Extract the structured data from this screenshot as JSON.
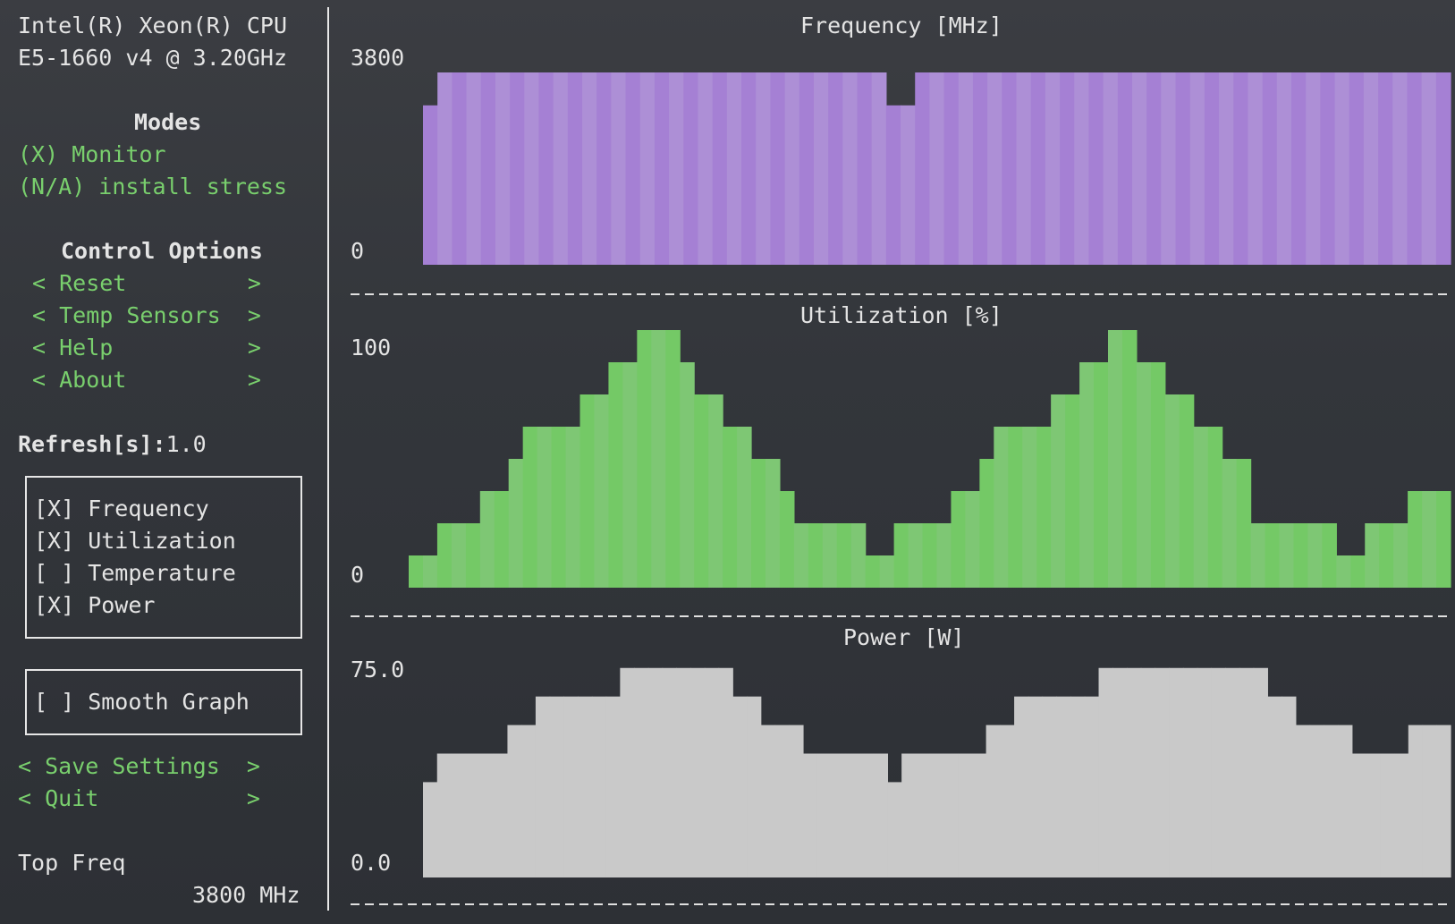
{
  "cpu": {
    "line1": "Intel(R) Xeon(R) CPU",
    "line2": "E5-1660 v4 @ 3.20GHz"
  },
  "modes": {
    "title": "Modes",
    "monitor": "(X) Monitor",
    "stress": "(N/A) install stress"
  },
  "control": {
    "title": "Control Options",
    "reset": "< Reset         >",
    "temp_sensors": "< Temp Sensors  >",
    "help": "< Help          >",
    "about": "< About         >"
  },
  "refresh": {
    "label": "Refresh[s]:",
    "value": "1.0"
  },
  "graph_toggles": {
    "frequency": "[X] Frequency",
    "utilization": "[X] Utilization",
    "temperature": "[ ] Temperature",
    "power": "[X] Power"
  },
  "smooth_graph": "[ ] Smooth Graph",
  "save_settings": "< Save Settings  >",
  "quit": "< Quit           >",
  "summary": {
    "label": "Top Freq",
    "value": "3800 MHz"
  },
  "colors": {
    "frequency": "#a580d4",
    "utilization": "#74c966",
    "power": "#c9c9c9",
    "accent": "#79cf6d"
  },
  "graphs": {
    "frequency": {
      "title": "Frequency [MHz]",
      "max_label": "3800",
      "min_label": "0",
      "max": 3800,
      "values": [
        3150,
        3800,
        3800,
        3800,
        3800,
        3800,
        3800,
        3800,
        3800,
        3800,
        3800,
        3800,
        3800,
        3800,
        3800,
        3800,
        3800,
        3800,
        3800,
        3800,
        3800,
        3800,
        3800,
        3800,
        3800,
        3800,
        3800,
        3800,
        3800,
        3800,
        3800,
        3800,
        3150,
        3150,
        3800,
        3800,
        3800,
        3800,
        3800,
        3800,
        3800,
        3800,
        3800,
        3800,
        3800,
        3800,
        3800,
        3800,
        3800,
        3800,
        3800,
        3800,
        3800,
        3800,
        3800,
        3800,
        3800,
        3800,
        3800,
        3800,
        3800,
        3800,
        3800,
        3800,
        3800,
        3800,
        3800,
        3800,
        3800,
        3800,
        3800
      ]
    },
    "utilization": {
      "title": "Utilization [%]",
      "max_label": "100",
      "min_label": "0",
      "max": 100,
      "values": [
        12.5,
        12.5,
        25,
        25,
        25,
        37.5,
        37.5,
        50,
        62.5,
        62.5,
        62.5,
        62.5,
        75,
        75,
        87.5,
        87.5,
        100,
        100,
        100,
        87.5,
        75,
        75,
        62.5,
        62.5,
        50,
        50,
        37.5,
        25,
        25,
        25,
        25,
        25,
        12.5,
        12.5,
        25,
        25,
        25,
        25,
        37.5,
        37.5,
        50,
        62.5,
        62.5,
        62.5,
        62.5,
        75,
        75,
        87.5,
        87.5,
        100,
        100,
        87.5,
        87.5,
        75,
        75,
        62.5,
        62.5,
        50,
        50,
        25,
        25,
        25,
        25,
        25,
        25,
        12.5,
        12.5,
        25,
        25,
        25,
        37.5,
        37.5,
        37.5
      ]
    },
    "power": {
      "title": "Power [W]",
      "max_label": "75.0",
      "min_label": "0.0",
      "max": 75,
      "values": [
        30.4,
        39.5,
        39.5,
        39.5,
        39.5,
        39.5,
        48.6,
        48.6,
        57.7,
        57.7,
        57.7,
        57.7,
        57.7,
        57.7,
        66.8,
        66.8,
        66.8,
        66.8,
        66.8,
        66.8,
        66.8,
        66.8,
        57.7,
        57.7,
        48.6,
        48.6,
        48.6,
        39.5,
        39.5,
        39.5,
        39.5,
        39.5,
        39.5,
        30.4,
        39.5,
        39.5,
        39.5,
        39.5,
        39.5,
        39.5,
        48.6,
        48.6,
        57.7,
        57.7,
        57.7,
        57.7,
        57.7,
        57.7,
        66.8,
        66.8,
        66.8,
        66.8,
        66.8,
        66.8,
        66.8,
        66.8,
        66.8,
        66.8,
        66.8,
        66.8,
        57.7,
        57.7,
        48.6,
        48.6,
        48.6,
        48.6,
        39.5,
        39.5,
        39.5,
        39.5,
        48.6,
        48.6,
        48.6
      ]
    }
  }
}
